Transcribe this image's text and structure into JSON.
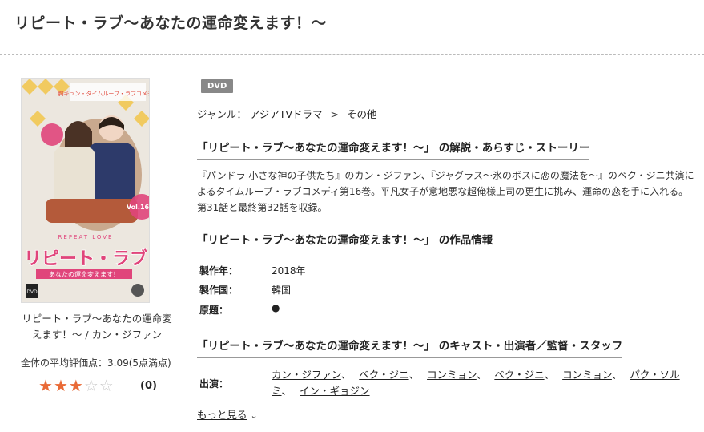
{
  "page_title": "リピート・ラブ～あなたの運命変えます！～",
  "cover": {
    "alt": "リピート・ラブ～あなたの運命変えます！～ / カン・ジファン",
    "logo_text": "リピート・ラブ",
    "logo_sub": "あなたの運命変えます！",
    "vol_text": "Vol.16",
    "repeat_love": "REPEAT LOVE",
    "tagline": "カン・ジファン ペク・ジニ",
    "colors": {
      "bg": "#ece7df",
      "pink": "#e0457b",
      "diamond": "#f2c64a",
      "red": "#e14a3d"
    }
  },
  "caption": "リピート・ラブ～あなたの運命変えます！～ / カン・ジファン",
  "rating": {
    "label": "全体の平均評価点：3.09(5点満点)",
    "filled_stars": 3,
    "total_stars": 5,
    "review_count": "(0)",
    "star_glyph_on": "★",
    "star_glyph_off": "☆"
  },
  "badge": "DVD",
  "genre": {
    "label": "ジャンル：",
    "items": [
      "アジアTVドラマ",
      "その他"
    ],
    "separator": ">"
  },
  "sections": {
    "story_heading": "「リピート・ラブ～あなたの運命変えます！～」 の解説・あらすじ・ストーリー",
    "story_text": "『パンドラ 小さな神の子供たち』のカン・ジファン、『ジャグラス～氷のボスに恋の魔法を～』のペク・ジニ共演によるタイムループ・ラブコメディ第16巻。平凡女子が意地悪な超俺様上司の更生に挑み、運命の恋を手に入れる。第31話と最終第32話を収録。",
    "info_heading": "「リピート・ラブ～あなたの運命変えます！～」 の作品情報",
    "info": [
      {
        "label": "製作年：",
        "value": "2018年"
      },
      {
        "label": "製作国：",
        "value": "韓国"
      },
      {
        "label": "原題：",
        "value": "●"
      }
    ],
    "cast_heading": "「リピート・ラブ～あなたの運命変えます！～」 のキャスト・出演者／監督・スタッフ",
    "cast_label": "出演：",
    "cast": [
      "カン・ジファン",
      "ペク・ジニ",
      "コンミョン",
      "ペク・ジニ",
      "コンミョン",
      "パク・ソルミ",
      "イン・ギョジン"
    ],
    "cast_separator": "、",
    "more_label": "もっと見る",
    "more_chevron": "⌄"
  }
}
